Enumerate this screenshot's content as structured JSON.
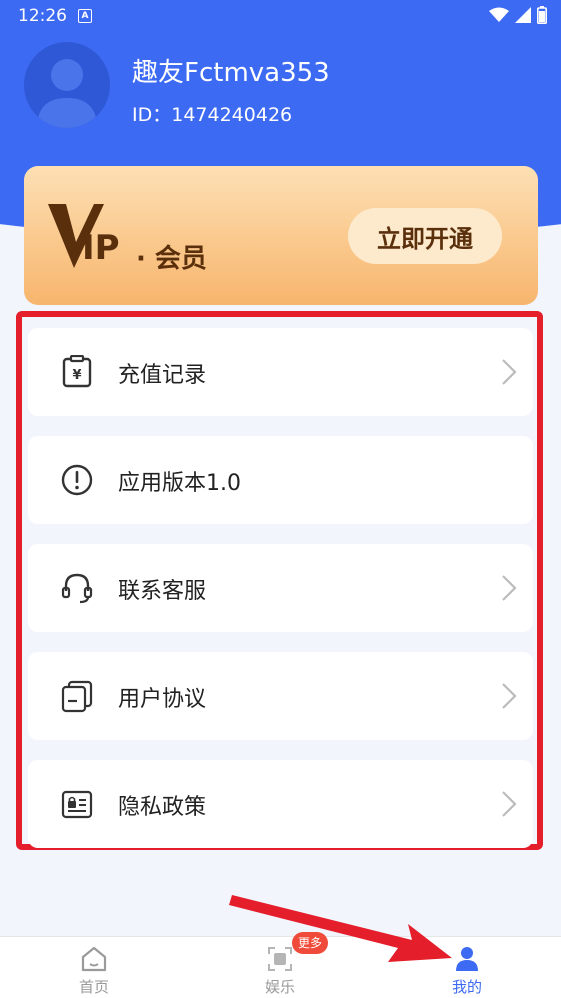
{
  "status_bar": {
    "time": "12:26",
    "notif": "A"
  },
  "profile": {
    "name": "趣友Fctmva353",
    "id": "ID：1474240426"
  },
  "vip": {
    "text": "IP",
    "suffix": "· 会员",
    "button": "立即开通"
  },
  "menu": [
    {
      "label": "充值记录",
      "icon": "wallet-icon"
    },
    {
      "label": "应用版本1.0",
      "icon": "info-icon"
    },
    {
      "label": "联系客服",
      "icon": "headset-icon"
    },
    {
      "label": "用户协议",
      "icon": "document-icon"
    },
    {
      "label": "隐私政策",
      "icon": "privacy-icon"
    }
  ],
  "tabs": [
    {
      "label": "首页",
      "icon": "home-icon"
    },
    {
      "label": "娱乐",
      "icon": "entertainment-icon",
      "badge": "更多"
    },
    {
      "label": "我的",
      "icon": "profile-icon"
    }
  ],
  "colors": {
    "primary": "#3d6af2",
    "highlight": "#e41e2b",
    "vip_dark": "#5a2f0c"
  }
}
